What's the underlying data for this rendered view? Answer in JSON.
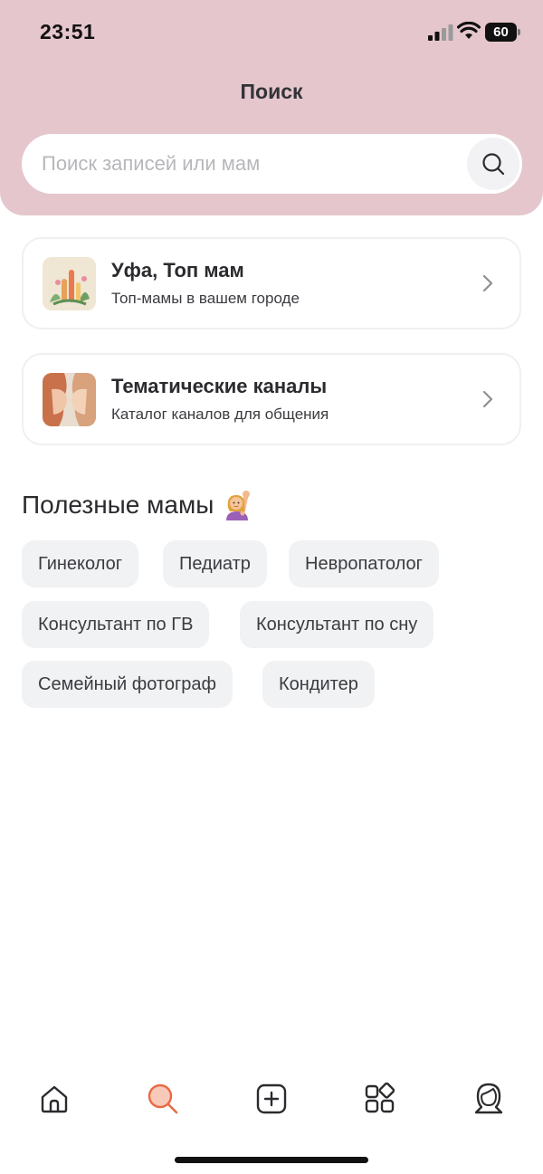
{
  "status_bar": {
    "time": "23:51",
    "battery": "60"
  },
  "header": {
    "title": "Поиск"
  },
  "search": {
    "placeholder": "Поиск записей или мам"
  },
  "cards": [
    {
      "title": "Уфа, Топ мам",
      "subtitle": "Топ-мамы в вашем городе",
      "icon": "city-illustration-icon"
    },
    {
      "title": "Тематические каналы",
      "subtitle": "Каталог каналов для общения",
      "icon": "channels-illustration-icon"
    }
  ],
  "useful_moms": {
    "title": "Полезные мамы",
    "emoji": "woman-raising-hand-icon",
    "chips": [
      "Гинеколог",
      "Педиатр",
      "Невропатолог",
      "Консультант по ГВ",
      "Консультант по сну",
      "Семейный фотограф",
      "Кондитер"
    ]
  },
  "tabbar": {
    "items": [
      {
        "icon": "home-icon",
        "active": false
      },
      {
        "icon": "search-icon",
        "active": true
      },
      {
        "icon": "add-post-icon",
        "active": false
      },
      {
        "icon": "catalog-icon",
        "active": false
      },
      {
        "icon": "profile-icon",
        "active": false
      }
    ]
  },
  "colors": {
    "header_bg": "#e5c6cd",
    "accent": "#e86a45",
    "chip_bg": "#f1f2f4"
  }
}
